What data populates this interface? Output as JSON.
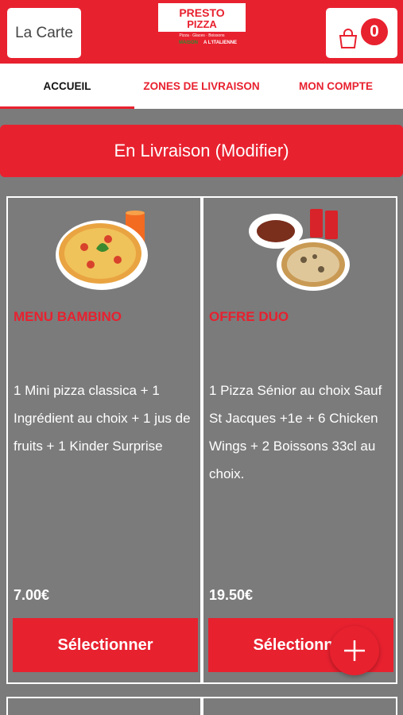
{
  "header": {
    "menu_label": "La Carte",
    "logo_text_1": "PRESTO",
    "logo_text_2": "PIZZA",
    "logo_sub": "Pizza · Glaces · Boissons",
    "logo_tagline_1": "MAISON",
    "logo_tagline_2": "A L'ITALIENNE",
    "cart_count": "0",
    "cart_icon": "shopping-bag-icon"
  },
  "tabs": [
    {
      "label": "ACCUEIL",
      "active": true
    },
    {
      "label": "ZONES DE LIVRAISON",
      "active": false
    },
    {
      "label": "MON COMPTE",
      "active": false
    }
  ],
  "delivery_banner": "En Livraison (Modifier)",
  "products": [
    {
      "title": "MENU BAMBINO",
      "description": "1 Mini pizza classica + 1 Ingrédient au choix + 1 jus de fruits + 1 Kinder Surprise",
      "price": "7.00€",
      "button": "Sélectionner",
      "image": "pizza-with-juice-image"
    },
    {
      "title": "OFFRE DUO",
      "description": "1 Pizza Sénior au choix Sauf St Jacques +1e + 6 Chicken Wings + 2 Boissons 33cl au choix.",
      "price": "19.50€",
      "button": "Sélectionner",
      "image": "pizza-wings-sodas-image"
    }
  ],
  "fab_icon": "plus-icon",
  "colors": {
    "brand_red": "#e8212f",
    "background_gray": "#7b7b7b"
  }
}
